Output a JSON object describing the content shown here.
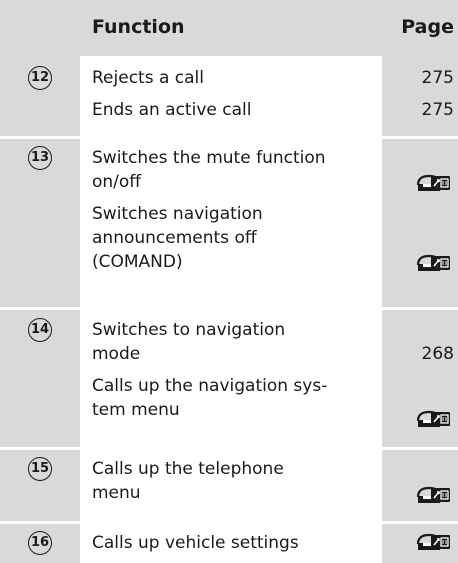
{
  "header": {
    "function": "Function",
    "page": "Page"
  },
  "rows": [
    {
      "num": "12",
      "items": [
        {
          "text": "Rejects a call",
          "page": "275"
        },
        {
          "text": "Ends an active call",
          "page": "275"
        }
      ]
    },
    {
      "num": "13",
      "items": [
        {
          "lines": [
            "Switches the mute function",
            "on/off"
          ],
          "icon": "display-icon"
        },
        {
          "lines": [
            "Switches navigation",
            "announcements off",
            "(COMAND)"
          ],
          "icon": "display-icon"
        }
      ]
    },
    {
      "num": "14",
      "items": [
        {
          "lines": [
            "Switches to navigation",
            "mode"
          ],
          "page": "268"
        },
        {
          "lines": [
            "Calls up the navigation sys-",
            "tem menu"
          ],
          "icon": "display-icon"
        }
      ]
    },
    {
      "num": "15",
      "items": [
        {
          "lines": [
            "Calls up the telephone",
            "menu"
          ],
          "icon": "display-icon"
        }
      ]
    },
    {
      "num": "16",
      "items": [
        {
          "text": "Calls up vehicle settings",
          "icon": "display-icon"
        }
      ]
    }
  ]
}
